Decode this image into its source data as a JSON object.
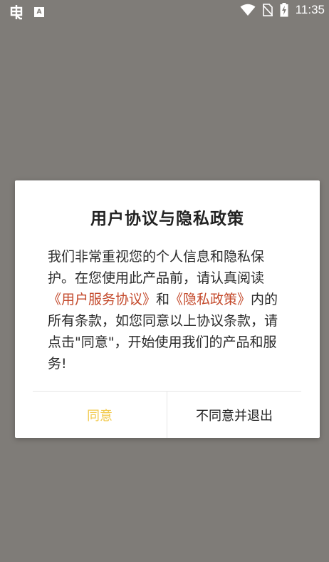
{
  "status_bar": {
    "time": "11:35",
    "icons": [
      "bug-icon",
      "a-icon",
      "wifi-icon",
      "no-sim-icon",
      "battery-charging-icon"
    ],
    "a_label": "A"
  },
  "dialog": {
    "title": "用户协议与隐私政策",
    "body": {
      "part1": "我们非常重视您的个人信息和隐私保护。在您使用此产品前，请认真阅读",
      "link_user_agreement": "《用户服务协议》",
      "part2": "和",
      "link_privacy_policy": "《隐私政策》",
      "part3": "内的所有条款，如您同意以上协议条款，请点击\"同意\"，开始使用我们的产品和服务!"
    },
    "buttons": {
      "agree": "同意",
      "disagree_exit": "不同意并退出"
    },
    "colors": {
      "agree": "#f2c94c",
      "link": "#c44a2c",
      "overlay": "#7f7c78"
    }
  }
}
